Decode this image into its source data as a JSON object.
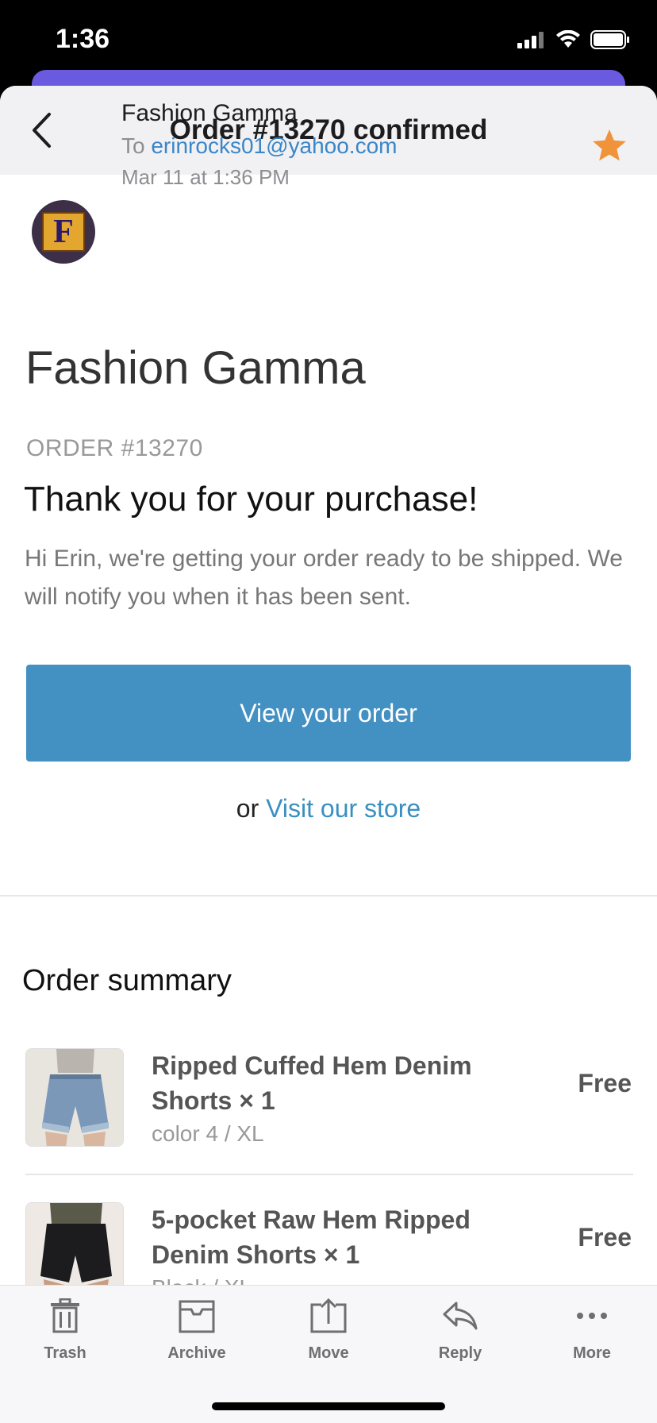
{
  "status_bar": {
    "time": "1:36"
  },
  "header": {
    "title": "Order #13270 confirmed",
    "back_label": "Back"
  },
  "sender": {
    "name": "Fashion Gamma",
    "to_prefix": "To",
    "to_email": "erinrocks01@yahoo.com",
    "date": "Mar 11 at 1:36 PM",
    "avatar_letter": "F",
    "starred": true,
    "star_color": "#f0933a"
  },
  "email": {
    "brand": "Fashion Gamma",
    "order_label": "ORDER #13270",
    "headline": "Thank you for your purchase!",
    "message": "Hi Erin, we're getting your order ready to be shipped. We will notify you when it has been sent.",
    "view_button": "View your order",
    "store_prefix": "or",
    "store_link": "Visit our store",
    "accent_color": "#4390c3"
  },
  "summary": {
    "title": "Order summary",
    "items": [
      {
        "name": "Ripped Cuffed Hem Denim Shorts × 1",
        "variant": "color 4 / XL",
        "price": "Free"
      },
      {
        "name": " 5-pocket Raw Hem Ripped Denim Shorts × 1",
        "variant": "Black / XL",
        "price": "Free"
      }
    ]
  },
  "toolbar": {
    "items": [
      {
        "label": "Trash",
        "icon": "trash-icon"
      },
      {
        "label": "Archive",
        "icon": "archive-icon"
      },
      {
        "label": "Move",
        "icon": "move-icon"
      },
      {
        "label": "Reply",
        "icon": "reply-icon"
      },
      {
        "label": "More",
        "icon": "more-icon"
      }
    ]
  }
}
